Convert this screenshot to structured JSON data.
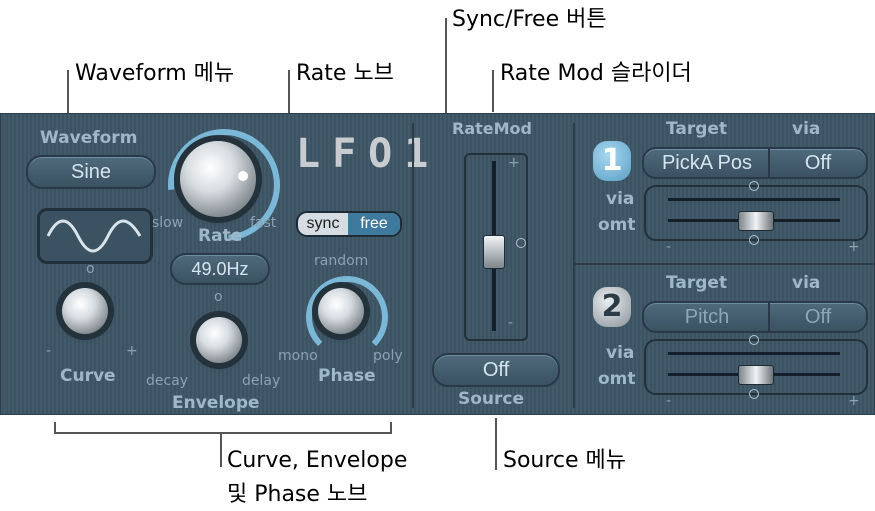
{
  "callouts": {
    "waveform_menu": "Waveform 메뉴",
    "rate_knob": "Rate 노브",
    "sync_free_button": "Sync/Free 버튼",
    "rate_mod_slider": "Rate Mod 슬라이더",
    "curve_envelope_phase": "Curve, Envelope",
    "curve_envelope_phase_2": "및 Phase 노브",
    "source_menu": "Source 메뉴"
  },
  "panel": {
    "title": "LFO1",
    "waveform_label": "Waveform",
    "waveform_value": "Sine",
    "rate_label": "Rate",
    "rate_slow": "slow",
    "rate_fast": "fast",
    "rate_value": "49.0Hz",
    "sync_label": "sync",
    "free_label": "free",
    "curve_label": "Curve",
    "curve_minus": "-",
    "curve_plus": "+",
    "envelope_label": "Envelope",
    "envelope_decay": "decay",
    "envelope_delay": "delay",
    "phase_label": "Phase",
    "phase_random": "random",
    "phase_mono": "mono",
    "phase_poly": "poly",
    "ratemod_label": "RateMod",
    "ratemod_plus": "+",
    "ratemod_minus": "-",
    "source_value": "Off",
    "source_label": "Source",
    "route1": {
      "number": "1",
      "target_label": "Target",
      "via_label": "via",
      "target_value": "PickA Pos",
      "via_value": "Off",
      "via_row": "via",
      "amt_row": "omt",
      "minus": "-",
      "plus": "+"
    },
    "route2": {
      "number": "2",
      "target_label": "Target",
      "via_label": "via",
      "target_value": "Pitch",
      "via_value": "Off",
      "via_row": "via",
      "amt_row": "omt",
      "minus": "-",
      "plus": "+"
    }
  },
  "colors": {
    "panel_bg": "#425a6a",
    "label": "#9fb8c7",
    "highlight": "#7bb8d8"
  },
  "icons": [
    "sine-wave-icon",
    "knob-indicator-icon"
  ]
}
